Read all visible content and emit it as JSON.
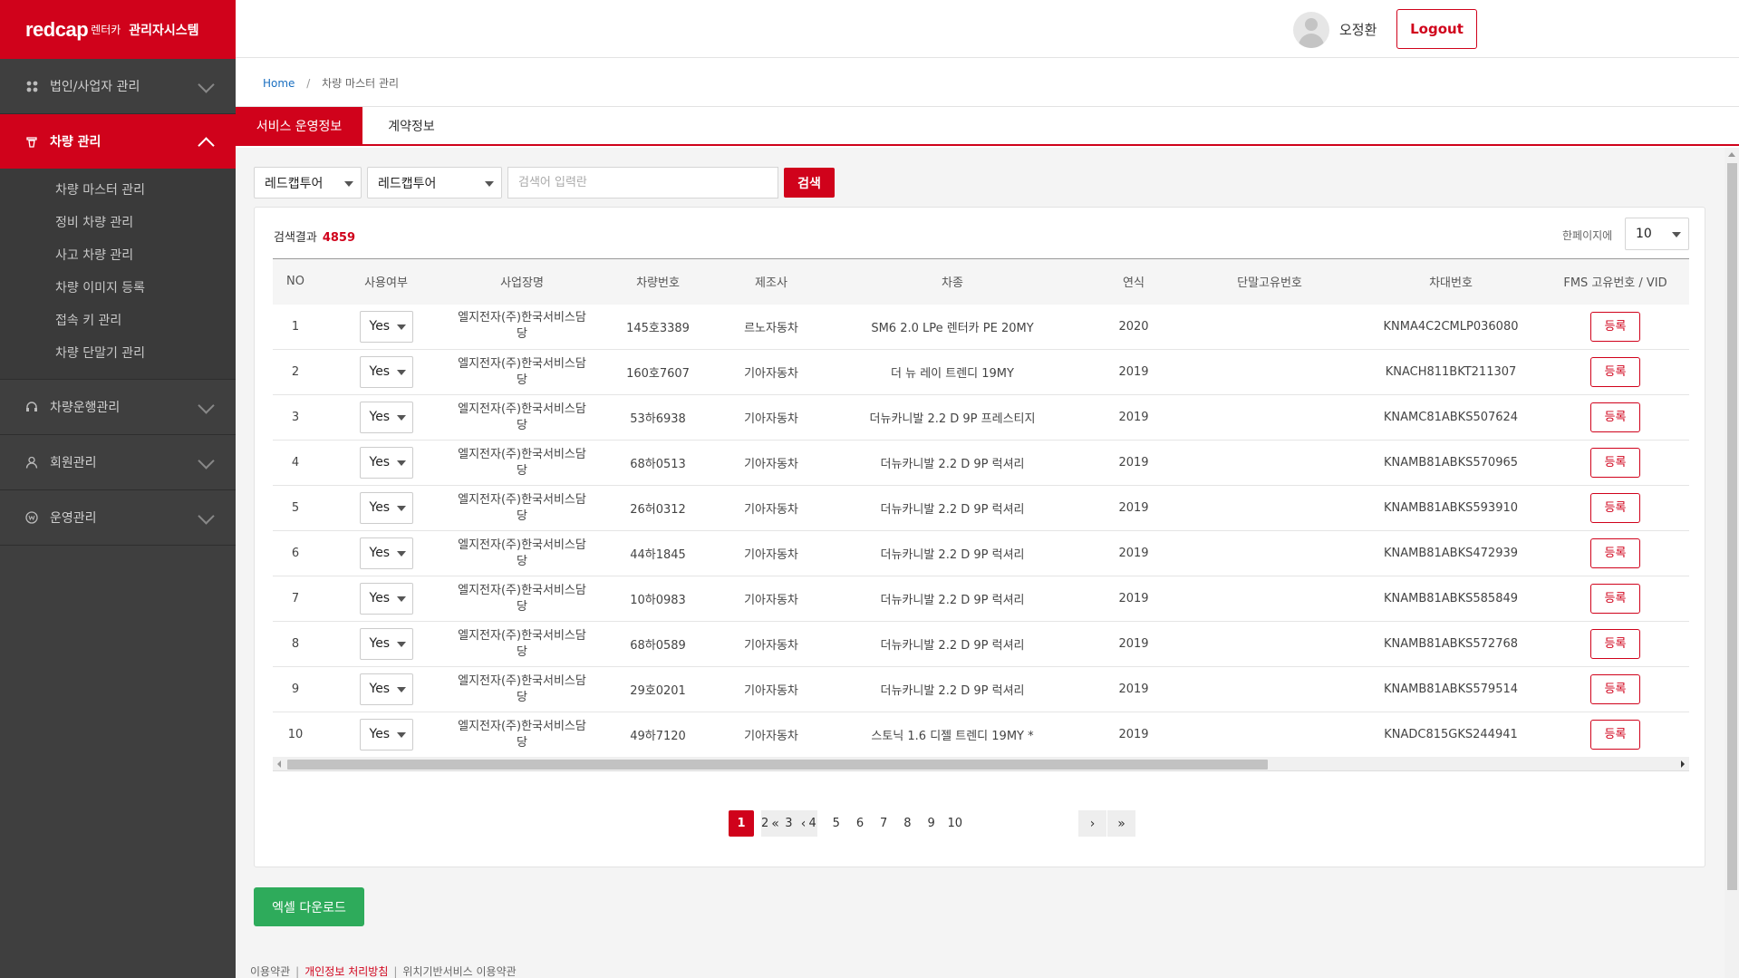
{
  "header": {
    "brand": "redcap",
    "brand_sub": "렌터카",
    "system_title": "관리자시스템",
    "username": "오정환",
    "logout_label": "Logout"
  },
  "sidebar": {
    "groups": [
      {
        "label": "법인/사업자 관리",
        "icon": "grid-icon",
        "expanded": false
      },
      {
        "label": "차량 관리",
        "icon": "car-icon",
        "expanded": true,
        "items": [
          {
            "label": "차량 마스터 관리"
          },
          {
            "label": "정비 차량 관리"
          },
          {
            "label": "사고 차량 관리"
          },
          {
            "label": "차량 이미지 등록"
          },
          {
            "label": "접속 키 관리"
          },
          {
            "label": "차량 단말기 관리"
          }
        ]
      },
      {
        "label": "차량운행관리",
        "icon": "headset-icon",
        "expanded": false
      },
      {
        "label": "회원관리",
        "icon": "user-icon",
        "expanded": false
      },
      {
        "label": "운영관리",
        "icon": "won-icon",
        "expanded": false
      }
    ]
  },
  "breadcrumb": {
    "home": "Home",
    "current": "차량 마스터 관리"
  },
  "tabs": [
    {
      "label": "서비스 운영정보",
      "active": true
    },
    {
      "label": "계약정보",
      "active": false
    }
  ],
  "filters": {
    "select1": "레드캡투어",
    "select2": "레드캡투어",
    "search_placeholder": "검색어 입력란",
    "search_label": "검색"
  },
  "results": {
    "label": "검색결과",
    "count": "4859",
    "per_page_label": "한페이지에",
    "per_page": "10"
  },
  "table": {
    "columns": [
      "NO",
      "사용여부",
      "사업장명",
      "차량번호",
      "제조사",
      "차종",
      "연식",
      "단말고유번호",
      "차대번호",
      "FMS 고유번호 / VID"
    ],
    "register_label": "등록",
    "rows": [
      {
        "no": "1",
        "use": "Yes",
        "biz": "엘지전자(주)한국서비스담당",
        "plate": "145호3389",
        "maker": "르노자동차",
        "model": "SM6 2.0 LPe 렌터카 PE 20MY",
        "year": "2020",
        "terminal": "",
        "vin": "KNMA4C2CMLP036080"
      },
      {
        "no": "2",
        "use": "Yes",
        "biz": "엘지전자(주)한국서비스담당",
        "plate": "160호7607",
        "maker": "기아자동차",
        "model": "더 뉴 레이 트렌디 19MY",
        "year": "2019",
        "terminal": "",
        "vin": "KNACH811BKT211307"
      },
      {
        "no": "3",
        "use": "Yes",
        "biz": "엘지전자(주)한국서비스담당",
        "plate": "53하6938",
        "maker": "기아자동차",
        "model": "더뉴카니발 2.2 D 9P 프레스티지",
        "year": "2019",
        "terminal": "",
        "vin": "KNAMC81ABKS507624"
      },
      {
        "no": "4",
        "use": "Yes",
        "biz": "엘지전자(주)한국서비스담당",
        "plate": "68하0513",
        "maker": "기아자동차",
        "model": "더뉴카니발 2.2 D 9P 럭셔리",
        "year": "2019",
        "terminal": "",
        "vin": "KNAMB81ABKS570965"
      },
      {
        "no": "5",
        "use": "Yes",
        "biz": "엘지전자(주)한국서비스담당",
        "plate": "26허0312",
        "maker": "기아자동차",
        "model": "더뉴카니발 2.2 D 9P 럭셔리",
        "year": "2019",
        "terminal": "",
        "vin": "KNAMB81ABKS593910"
      },
      {
        "no": "6",
        "use": "Yes",
        "biz": "엘지전자(주)한국서비스담당",
        "plate": "44하1845",
        "maker": "기아자동차",
        "model": "더뉴카니발 2.2 D 9P 럭셔리",
        "year": "2019",
        "terminal": "",
        "vin": "KNAMB81ABKS472939"
      },
      {
        "no": "7",
        "use": "Yes",
        "biz": "엘지전자(주)한국서비스담당",
        "plate": "10하0983",
        "maker": "기아자동차",
        "model": "더뉴카니발 2.2 D 9P 럭셔리",
        "year": "2019",
        "terminal": "",
        "vin": "KNAMB81ABKS585849"
      },
      {
        "no": "8",
        "use": "Yes",
        "biz": "엘지전자(주)한국서비스담당",
        "plate": "68하0589",
        "maker": "기아자동차",
        "model": "더뉴카니발 2.2 D 9P 럭셔리",
        "year": "2019",
        "terminal": "",
        "vin": "KNAMB81ABKS572768"
      },
      {
        "no": "9",
        "use": "Yes",
        "biz": "엘지전자(주)한국서비스담당",
        "plate": "29호0201",
        "maker": "기아자동차",
        "model": "더뉴카니발 2.2 D 9P 럭셔리",
        "year": "2019",
        "terminal": "",
        "vin": "KNAMB81ABKS579514"
      },
      {
        "no": "10",
        "use": "Yes",
        "biz": "엘지전자(주)한국서비스담당",
        "plate": "49하7120",
        "maker": "기아자동차",
        "model": "스토닉 1.6 디젤 트렌디 19MY *",
        "year": "2019",
        "terminal": "",
        "vin": "KNADC815GKS244941"
      }
    ]
  },
  "pagination": {
    "first": "«",
    "prev": "‹",
    "pages": [
      "1",
      "2",
      "3",
      "4",
      "5",
      "6",
      "7",
      "8",
      "9",
      "10"
    ],
    "current": "1",
    "next": "›",
    "last": "»"
  },
  "excel_label": "엑셀 다운로드",
  "footer": {
    "terms": "이용약관",
    "privacy": "개인정보 처리방침",
    "location_terms": "위치기반서비스 이용약관"
  },
  "colors": {
    "brand_red": "#d0021b",
    "excel_green": "#2eab5b",
    "sidebar_bg": "#3f3f3f"
  }
}
